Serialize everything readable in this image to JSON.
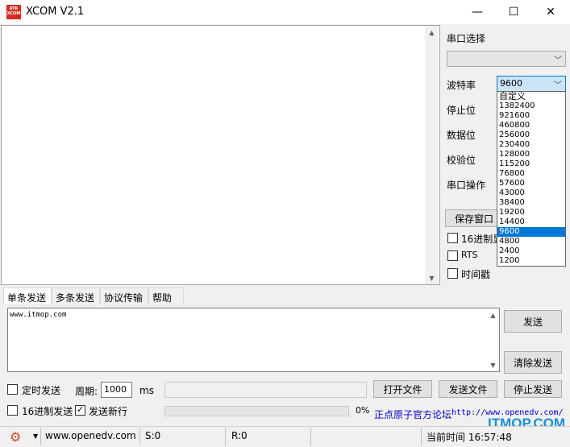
{
  "window": {
    "logo_text": "ATK XCOM",
    "title": "XCOM V2.1",
    "minimize": "—",
    "maximize": "☐",
    "close": "✕"
  },
  "panel": {
    "port_select_label": "串口选择",
    "port_value": "",
    "baud_label": "波特率",
    "baud_value": "9600",
    "stop_label": "停止位",
    "data_label": "数据位",
    "parity_label": "校验位",
    "port_op_label": "串口操作",
    "save_window_button": "保存窗口",
    "hex_display_label": "16进制显",
    "rts_label": "RTS",
    "timestamp_label": "时间戳"
  },
  "baud_options": [
    "自定义",
    "1382400",
    "921600",
    "460800",
    "256000",
    "230400",
    "128000",
    "115200",
    "76800",
    "57600",
    "43000",
    "38400",
    "19200",
    "14400",
    "9600",
    "4800",
    "2400",
    "1200"
  ],
  "baud_selected": "9600",
  "tabs": [
    "单条发送",
    "多条发送",
    "协议传输",
    "帮助"
  ],
  "send": {
    "text": "www.itmop.com",
    "send_button": "发送",
    "clear_button": "清除发送",
    "timed_send_label": "定时发送",
    "period_label": "周期:",
    "period_value": "1000",
    "ms_label": "ms",
    "open_file_button": "打开文件",
    "send_file_button": "发送文件",
    "stop_send_button": "停止发送",
    "hex_send_label": "16进制发送",
    "newline_label": "发送新行",
    "progress_label": "0%",
    "progress": 0,
    "site_link": "正点原子官方论坛",
    "site_url": "http://www.openedv.com/"
  },
  "watermark": "ITMOP.COM",
  "status": {
    "url": "www.openedv.com",
    "s_count": "S:0",
    "r_count": "R:0",
    "time_label": "当前时间 16:57:48"
  },
  "colors": {
    "accent": "#0078d7",
    "logo": "#d82a20",
    "link": "#0000cc",
    "watermark": "#1a8fd6"
  }
}
